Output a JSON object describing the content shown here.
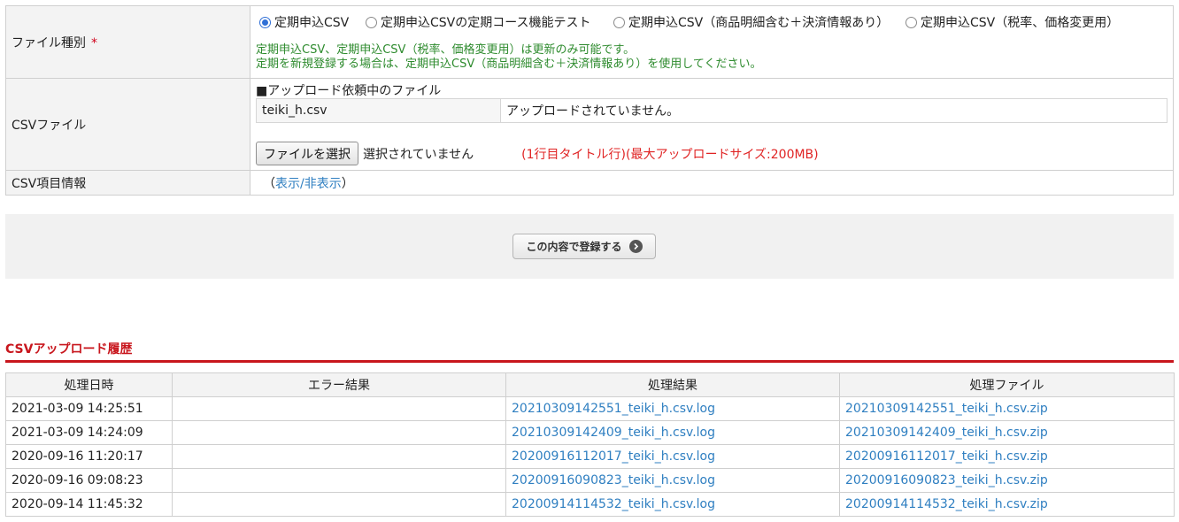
{
  "form": {
    "file_type": {
      "label": "ファイル種別",
      "required_mark": "*",
      "options": [
        {
          "label": "定期申込CSV",
          "selected": true
        },
        {
          "label": "定期申込CSVの定期コース機能テスト",
          "selected": false
        },
        {
          "label": "定期申込CSV（商品明細含む＋決済情報あり）",
          "selected": false
        },
        {
          "label": "定期申込CSV（税率、価格変更用）",
          "selected": false
        }
      ],
      "note_line1": "定期申込CSV、定期申込CSV（税率、価格変更用）は更新のみ可能です。",
      "note_line2": "定期を新規登録する場合は、定期申込CSV（商品明細含む＋決済情報あり）を使用してください。"
    },
    "csv_file": {
      "label": "CSVファイル",
      "pending_heading": "■アップロード依頼中のファイル",
      "pending_name": "teiki_h.csv",
      "pending_status": "アップロードされていません。",
      "choose_button": "ファイルを選択",
      "no_file_selected": "選択されていません",
      "note": "(1行目タイトル行)(最大アップロードサイズ:200MB)"
    },
    "csv_info": {
      "label": "CSV項目情報",
      "paren_open": "（",
      "toggle_link": "表示/非表示",
      "paren_close": "）"
    }
  },
  "submit": {
    "label": "この内容で登録する"
  },
  "history": {
    "title": "CSVアップロード履歴",
    "columns": [
      "処理日時",
      "エラー結果",
      "処理結果",
      "処理ファイル"
    ],
    "rows": [
      {
        "date": "2021-03-09 14:25:51",
        "error": "",
        "result": "20210309142551_teiki_h.csv.log",
        "file": "20210309142551_teiki_h.csv.zip"
      },
      {
        "date": "2021-03-09 14:24:09",
        "error": "",
        "result": "20210309142409_teiki_h.csv.log",
        "file": "20210309142409_teiki_h.csv.zip"
      },
      {
        "date": "2020-09-16 11:20:17",
        "error": "",
        "result": "20200916112017_teiki_h.csv.log",
        "file": "20200916112017_teiki_h.csv.zip"
      },
      {
        "date": "2020-09-16 09:08:23",
        "error": "",
        "result": "20200916090823_teiki_h.csv.log",
        "file": "20200916090823_teiki_h.csv.zip"
      },
      {
        "date": "2020-09-14 11:45:32",
        "error": "",
        "result": "20200914114532_teiki_h.csv.log",
        "file": "20200914114532_teiki_h.csv.zip"
      }
    ]
  },
  "colors": {
    "note_green": "#2e8b2e",
    "note_red": "#e02424",
    "accent_red": "#c8161d",
    "link_blue": "#2f7fc1"
  },
  "icons": {
    "submit_arrow": "arrow-right-circle-icon",
    "radio": "radio-icon"
  }
}
